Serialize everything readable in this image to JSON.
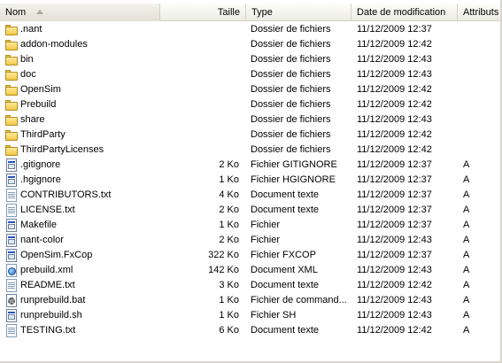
{
  "columns": {
    "name": "Nom",
    "size": "Taille",
    "type": "Type",
    "date": "Date de modification",
    "attr": "Attributs"
  },
  "files": [
    {
      "name": ".nant",
      "size": "",
      "type": "Dossier de fichiers",
      "date": "11/12/2009 12:37",
      "attr": "",
      "icon": "folder-icon"
    },
    {
      "name": "addon-modules",
      "size": "",
      "type": "Dossier de fichiers",
      "date": "11/12/2009 12:42",
      "attr": "",
      "icon": "folder-icon"
    },
    {
      "name": "bin",
      "size": "",
      "type": "Dossier de fichiers",
      "date": "11/12/2009 12:43",
      "attr": "",
      "icon": "folder-icon"
    },
    {
      "name": "doc",
      "size": "",
      "type": "Dossier de fichiers",
      "date": "11/12/2009 12:43",
      "attr": "",
      "icon": "folder-icon"
    },
    {
      "name": "OpenSim",
      "size": "",
      "type": "Dossier de fichiers",
      "date": "11/12/2009 12:42",
      "attr": "",
      "icon": "folder-icon"
    },
    {
      "name": "Prebuild",
      "size": "",
      "type": "Dossier de fichiers",
      "date": "11/12/2009 12:42",
      "attr": "",
      "icon": "folder-icon"
    },
    {
      "name": "share",
      "size": "",
      "type": "Dossier de fichiers",
      "date": "11/12/2009 12:43",
      "attr": "",
      "icon": "folder-icon"
    },
    {
      "name": "ThirdParty",
      "size": "",
      "type": "Dossier de fichiers",
      "date": "11/12/2009 12:42",
      "attr": "",
      "icon": "folder-icon"
    },
    {
      "name": "ThirdPartyLicenses",
      "size": "",
      "type": "Dossier de fichiers",
      "date": "11/12/2009 12:42",
      "attr": "",
      "icon": "folder-icon"
    },
    {
      "name": ".gitignore",
      "size": "2 Ko",
      "type": "Fichier GITIGNORE",
      "date": "11/12/2009 12:37",
      "attr": "A",
      "icon": "generic-file-icon"
    },
    {
      "name": ".hgignore",
      "size": "1 Ko",
      "type": "Fichier HGIGNORE",
      "date": "11/12/2009 12:37",
      "attr": "A",
      "icon": "generic-file-icon"
    },
    {
      "name": "CONTRIBUTORS.txt",
      "size": "4 Ko",
      "type": "Document texte",
      "date": "11/12/2009 12:37",
      "attr": "A",
      "icon": "text-file-icon"
    },
    {
      "name": "LICENSE.txt",
      "size": "2 Ko",
      "type": "Document texte",
      "date": "11/12/2009 12:37",
      "attr": "A",
      "icon": "text-file-icon"
    },
    {
      "name": "Makefile",
      "size": "1 Ko",
      "type": "Fichier",
      "date": "11/12/2009 12:37",
      "attr": "A",
      "icon": "generic-file-icon"
    },
    {
      "name": "nant-color",
      "size": "2 Ko",
      "type": "Fichier",
      "date": "11/12/2009 12:43",
      "attr": "A",
      "icon": "generic-file-icon"
    },
    {
      "name": "OpenSim.FxCop",
      "size": "322 Ko",
      "type": "Fichier FXCOP",
      "date": "11/12/2009 12:37",
      "attr": "A",
      "icon": "generic-file-icon"
    },
    {
      "name": "prebuild.xml",
      "size": "142 Ko",
      "type": "Document XML",
      "date": "11/12/2009 12:43",
      "attr": "A",
      "icon": "xml-file-icon"
    },
    {
      "name": "README.txt",
      "size": "3 Ko",
      "type": "Document texte",
      "date": "11/12/2009 12:42",
      "attr": "A",
      "icon": "text-file-icon"
    },
    {
      "name": "runprebuild.bat",
      "size": "1 Ko",
      "type": "Fichier de command...",
      "date": "11/12/2009 12:43",
      "attr": "A",
      "icon": "batch-file-icon"
    },
    {
      "name": "runprebuild.sh",
      "size": "1 Ko",
      "type": "Fichier SH",
      "date": "11/12/2009 12:43",
      "attr": "A",
      "icon": "generic-file-icon"
    },
    {
      "name": "TESTING.txt",
      "size": "6 Ko",
      "type": "Document texte",
      "date": "11/12/2009 12:42",
      "attr": "A",
      "icon": "text-file-icon"
    }
  ]
}
